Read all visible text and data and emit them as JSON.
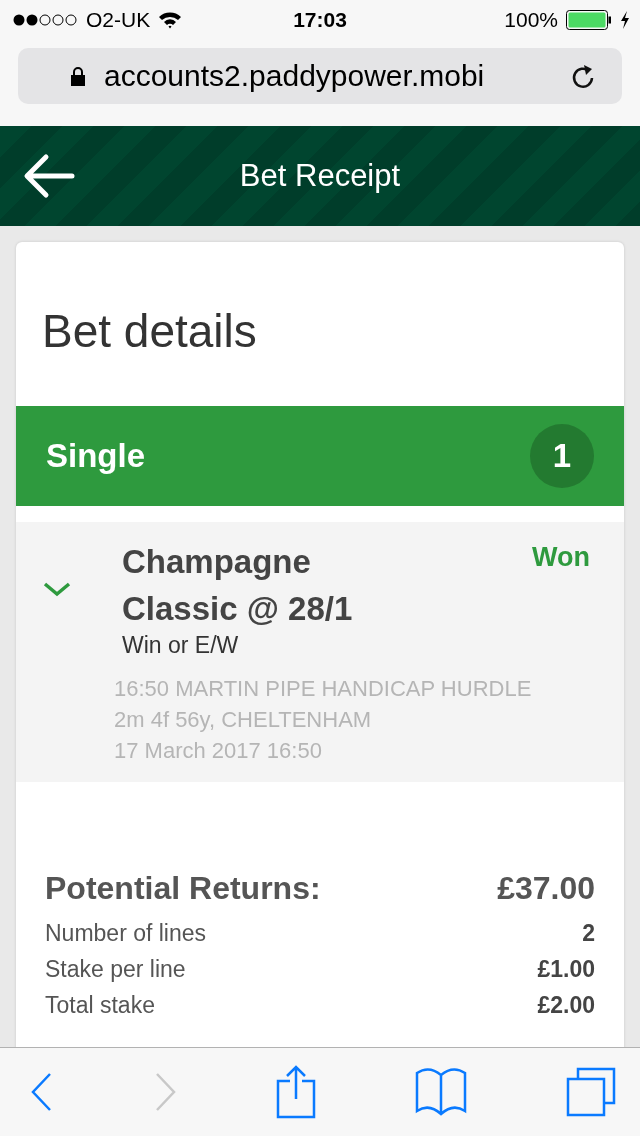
{
  "status_bar": {
    "carrier": "O2-UK",
    "time": "17:03",
    "battery": "100%"
  },
  "address_bar": {
    "url": "accounts2.paddypower.mobi"
  },
  "header": {
    "title": "Bet Receipt"
  },
  "card": {
    "title": "Bet details",
    "bet_type": {
      "label": "Single",
      "count": "1"
    },
    "selection": {
      "name": "Champagne Classic @ 28/1",
      "market": "Win or E/W",
      "result": "Won",
      "event": "16:50 MARTIN PIPE HANDICAP HURDLE 2m 4f 56y, CHELTENHAM",
      "date": "17 March 2017 16:50"
    },
    "potential_returns": {
      "label": "Potential Returns:",
      "value": "£37.00"
    },
    "summary": [
      {
        "label": "Number of lines",
        "value": "2"
      },
      {
        "label": "Stake per line",
        "value": "£1.00"
      },
      {
        "label": "Total stake",
        "value": "£2.00"
      }
    ]
  },
  "toolbar": [
    {
      "kind": "back",
      "disabled": false
    },
    {
      "kind": "forward",
      "disabled": true
    },
    {
      "kind": "share",
      "disabled": false
    },
    {
      "kind": "bookmarks",
      "disabled": false
    },
    {
      "kind": "tabs",
      "disabled": false
    }
  ]
}
